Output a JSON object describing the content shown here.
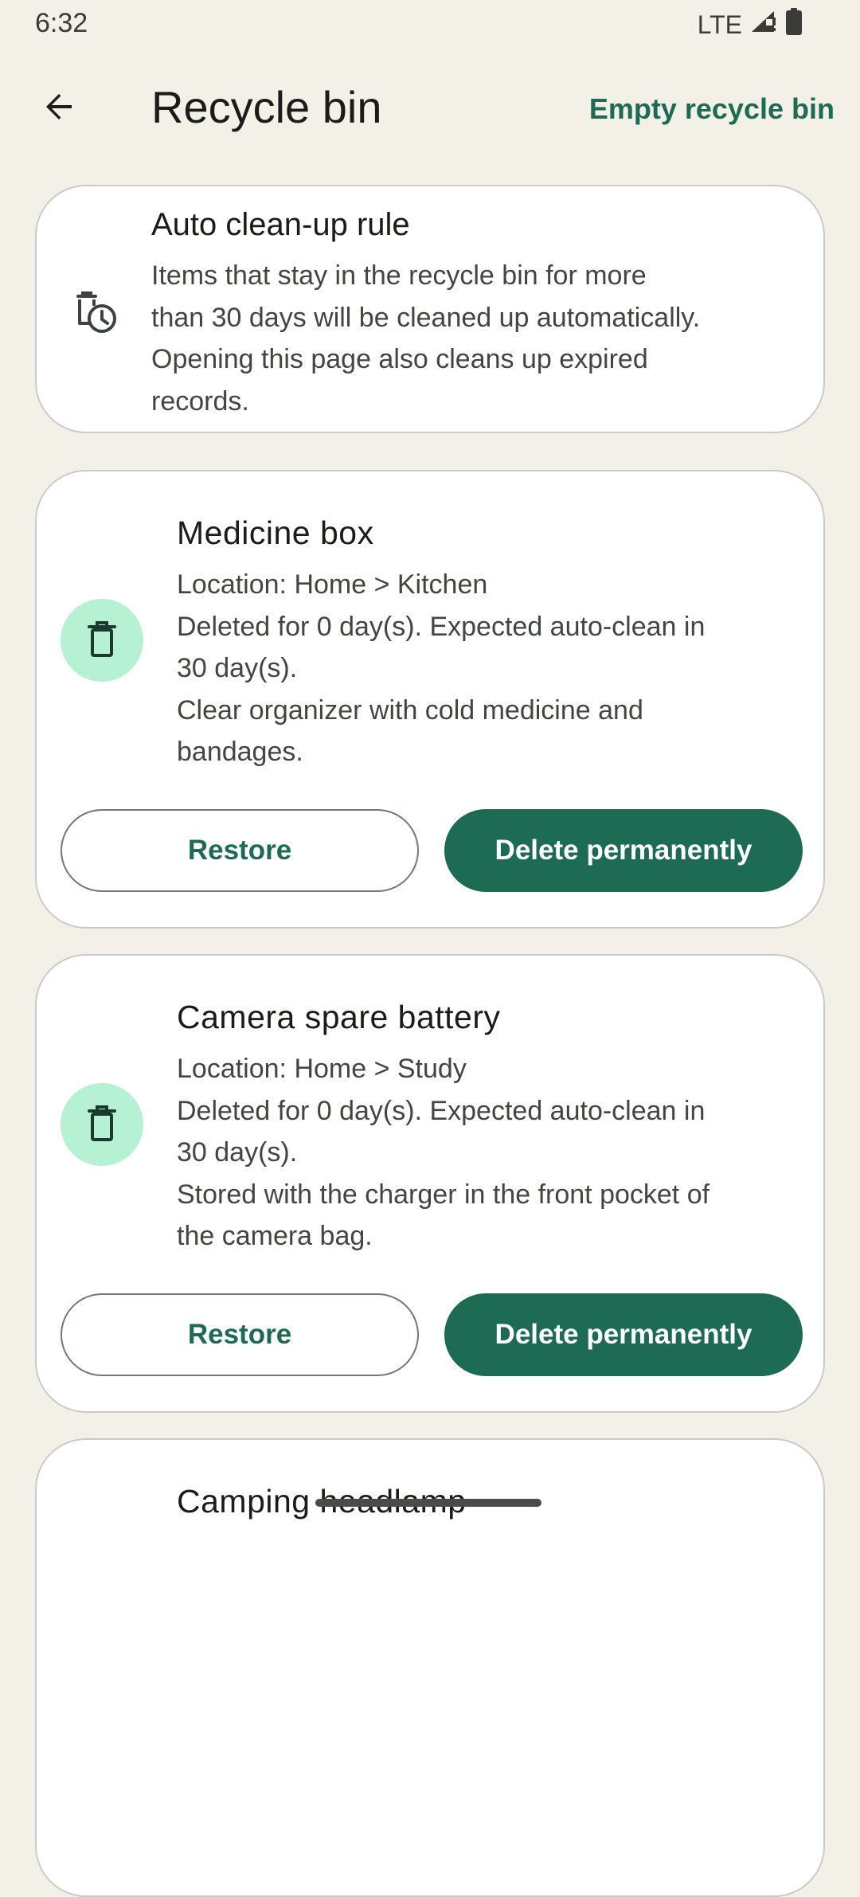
{
  "status_bar": {
    "time": "6:32",
    "network": "LTE",
    "signal_icon": "signal-icon",
    "battery_icon": "battery-icon"
  },
  "app_bar": {
    "back_icon": "arrow-back-icon",
    "title": "Recycle bin",
    "action_label": "Empty recycle bin"
  },
  "info_card": {
    "icon": "trash-clock-icon",
    "title": "Auto clean-up rule",
    "lines": [
      "Items that stay in the recycle bin for more",
      "than 30 days will be cleaned up automatically.",
      "Opening this page also cleans up expired",
      "records."
    ]
  },
  "items": [
    {
      "title": "Medicine box",
      "lines": [
        "Location: Home > Kitchen",
        "Deleted for 0 day(s). Expected auto-clean in",
        "30 day(s).",
        "Clear organizer with cold medicine and",
        "bandages."
      ],
      "restore_label": "Restore",
      "delete_label": "Delete permanently"
    },
    {
      "title": "Camera spare battery",
      "lines": [
        "Location: Home > Study",
        "Deleted for 0 day(s). Expected auto-clean in",
        "30 day(s).",
        "Stored with the charger in the front pocket of",
        "the camera bag."
      ],
      "restore_label": "Restore",
      "delete_label": "Delete permanently"
    },
    {
      "title": "Camping headlamp"
    }
  ],
  "colors": {
    "background": "#f3f1e7",
    "accent": "#1d6b52",
    "icon_circle": "#b6f1d3"
  }
}
